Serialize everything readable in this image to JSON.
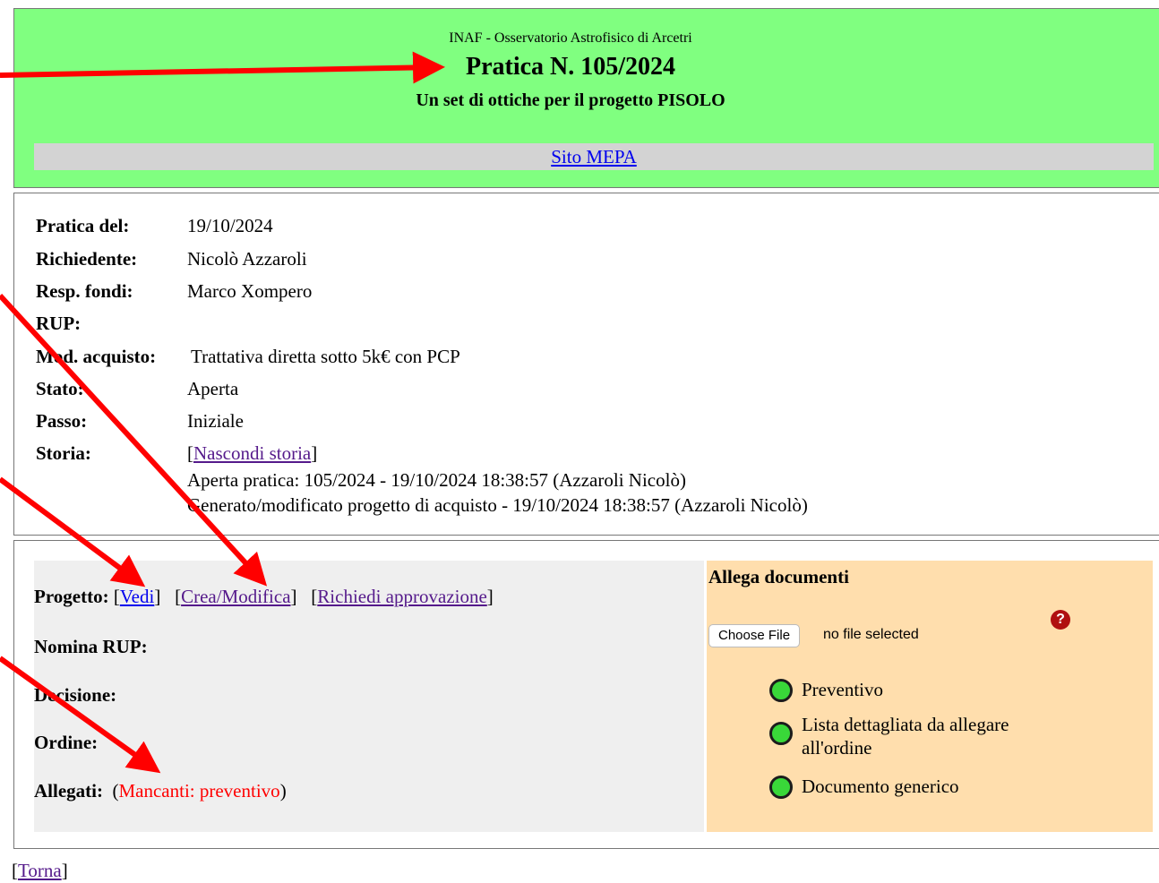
{
  "header": {
    "org": "INAF - Osservatorio Astrofisico di Arcetri",
    "title": "Pratica N. 105/2024",
    "subtitle": "Un set di ottiche per il progetto PISOLO",
    "mepa_link": "Sito MEPA"
  },
  "info": {
    "pratica_del": {
      "label": "Pratica del:",
      "value": "19/10/2024"
    },
    "richiedente": {
      "label": "Richiedente:",
      "value": "Nicolò Azzaroli"
    },
    "resp_fondi": {
      "label": "Resp. fondi:",
      "value": "Marco Xompero"
    },
    "rup": {
      "label": "RUP:",
      "value": ""
    },
    "mod_acquisto": {
      "label": "Mod. acquisto:",
      "value": "Trattativa diretta sotto 5k€ con PCP"
    },
    "stato": {
      "label": "Stato:",
      "value": "Aperta"
    },
    "passo": {
      "label": "Passo:",
      "value": "Iniziale"
    },
    "storia": {
      "label": "Storia:",
      "toggle_link": "Nascondi storia",
      "entries": [
        "Aperta pratica: 105/2024 - 19/10/2024 18:38:57 (Azzaroli Nicolò)",
        "Generato/modificato progetto di acquisto - 19/10/2024 18:38:57 (Azzaroli Nicolò)"
      ]
    }
  },
  "actions": {
    "progetto": {
      "label": "Progetto:",
      "links": [
        "Vedi",
        "Crea/Modifica",
        "Richiedi approvazione"
      ]
    },
    "nomina_rup": "Nomina RUP:",
    "decisione": "Decisione:",
    "ordine": "Ordine:",
    "allegati": {
      "label": "Allegati:",
      "missing": "Mancanti: preventivo"
    }
  },
  "allega": {
    "title": "Allega documenti",
    "file_button": "Choose File",
    "file_status": "no file selected",
    "help_icon": "?",
    "options": [
      "Preventivo",
      "Lista dettagliata da allegare all'ordine",
      "Documento generico"
    ],
    "options_line2": [
      "",
      "all'ordine",
      ""
    ],
    "options_line1": [
      "Preventivo",
      "Lista dettagliata da allegare",
      "Documento generico"
    ]
  },
  "footer": {
    "torna_link": "Torna"
  },
  "colors": {
    "header_bg": "#80ff80",
    "panel_bg": "#efefef",
    "allega_bg": "#ffdead",
    "arrow": "#ff0000",
    "radio": "#39d839"
  }
}
